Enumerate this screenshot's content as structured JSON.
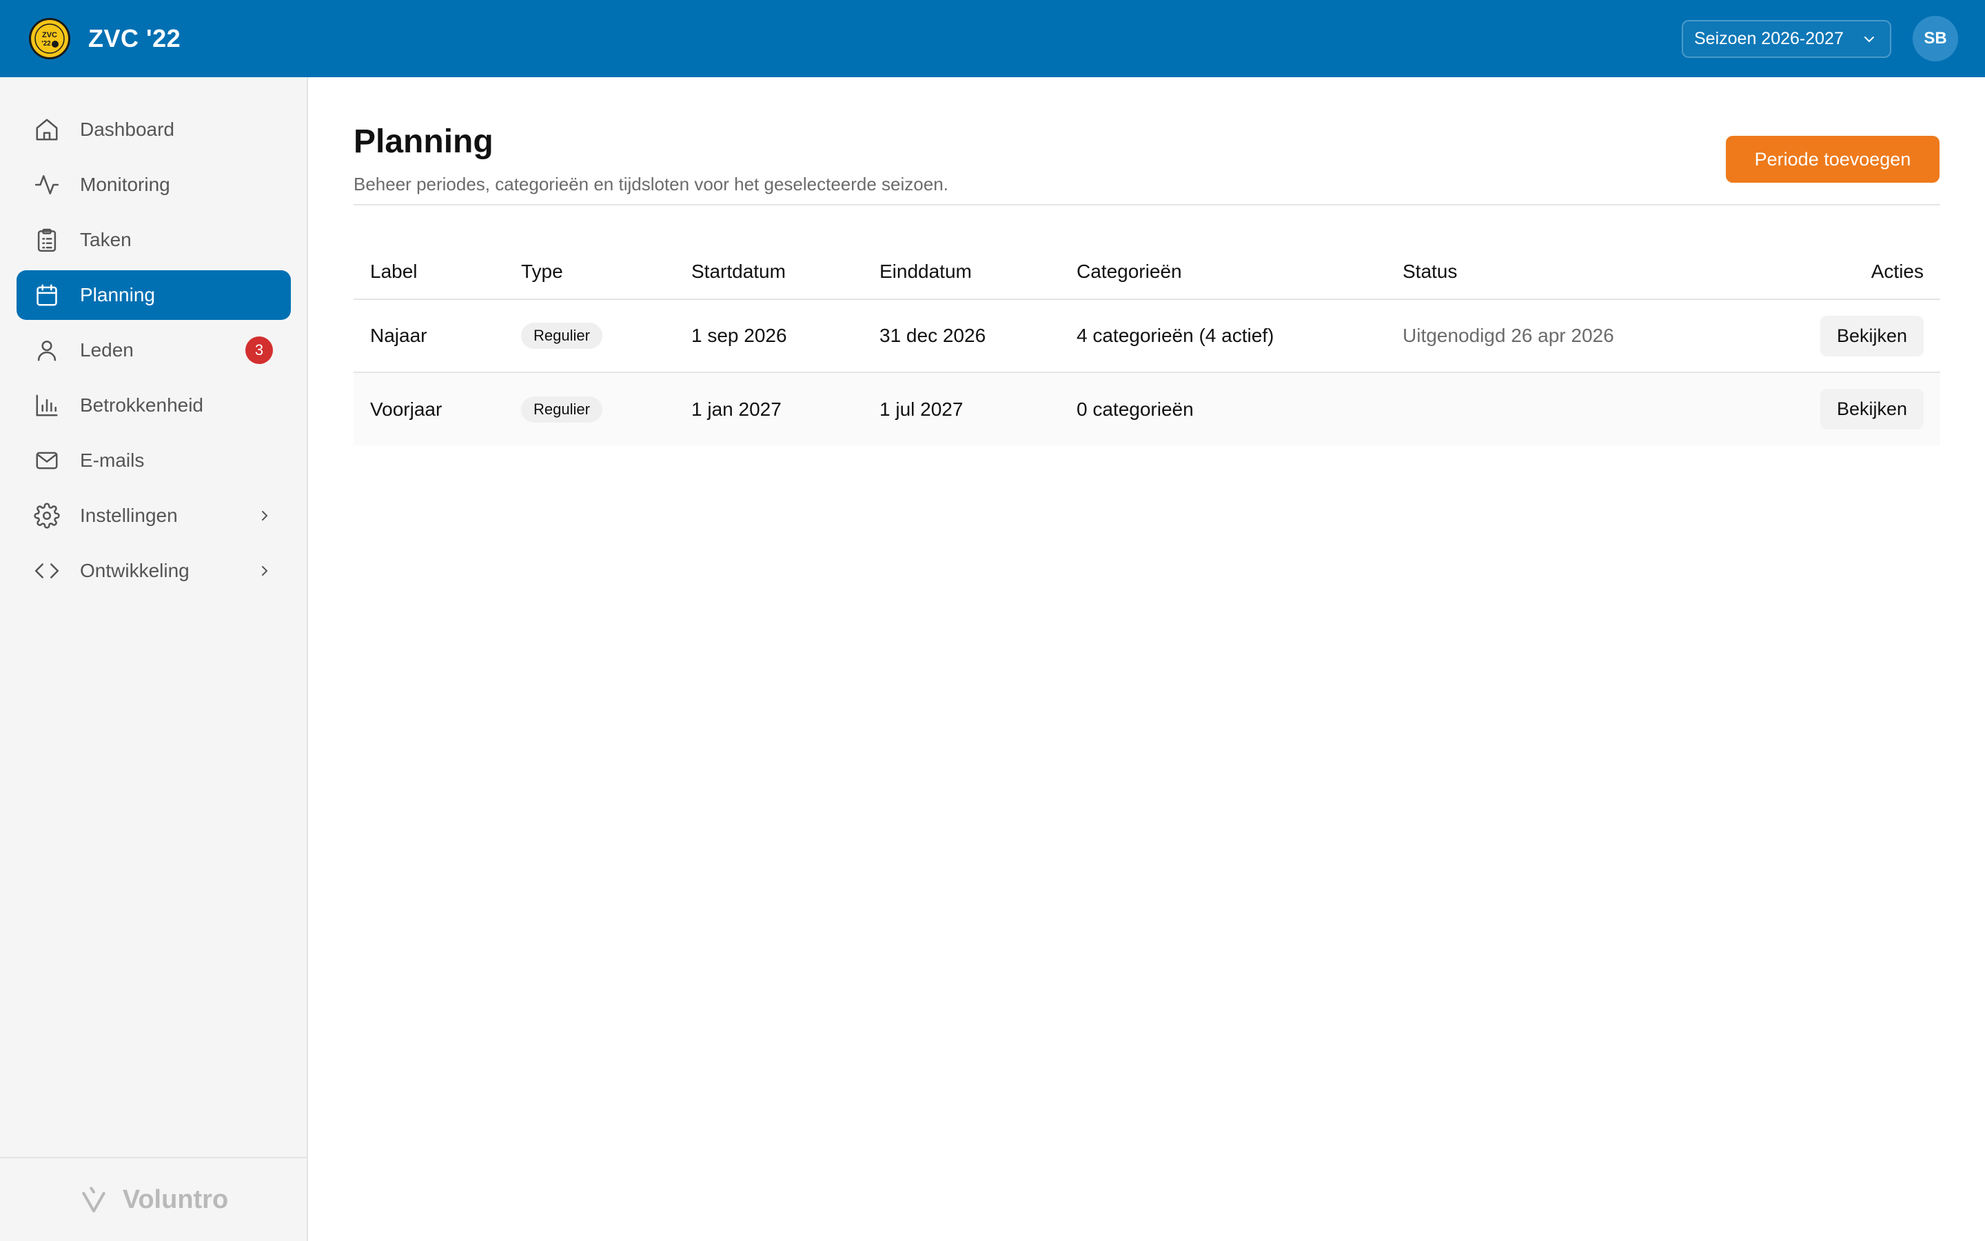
{
  "app": {
    "name": "ZVC '22",
    "logo_text": "ZVC '22"
  },
  "header": {
    "season_select": "Seizoen 2026-2027",
    "avatar_initials": "SB",
    "brand_color": "#0070B3"
  },
  "sidebar": {
    "items": [
      {
        "label": "Dashboard",
        "icon": "home-icon"
      },
      {
        "label": "Monitoring",
        "icon": "activity-icon"
      },
      {
        "label": "Taken",
        "icon": "clipboard-icon"
      },
      {
        "label": "Planning",
        "icon": "calendar-icon",
        "active": true
      },
      {
        "label": "Leden",
        "icon": "user-icon",
        "badge": "3"
      },
      {
        "label": "Betrokkenheid",
        "icon": "bar-chart-icon"
      },
      {
        "label": "E-mails",
        "icon": "mail-icon"
      },
      {
        "label": "Instellingen",
        "icon": "gear-icon",
        "has_submenu": true
      },
      {
        "label": "Ontwikkeling",
        "icon": "code-icon",
        "has_submenu": true
      }
    ],
    "footer_brand": "Voluntro"
  },
  "page": {
    "title": "Planning",
    "subtitle": "Beheer periodes, categorieën en tijdsloten voor het geselecteerde seizoen.",
    "add_button": "Periode toevoegen",
    "accent_color": "#EE7A1B"
  },
  "table": {
    "columns": [
      "Label",
      "Type",
      "Startdatum",
      "Einddatum",
      "Categorieën",
      "Status",
      "Acties"
    ],
    "rows": [
      {
        "label": "Najaar",
        "type": "Regulier",
        "start": "1 sep 2026",
        "end": "31 dec 2026",
        "categories": "4 categorieën (4 actief)",
        "status": "Uitgenodigd 26 apr 2026",
        "action": "Bekijken"
      },
      {
        "label": "Voorjaar",
        "type": "Regulier",
        "start": "1 jan 2027",
        "end": "1 jul 2027",
        "categories": "0 categorieën",
        "status": "",
        "action": "Bekijken"
      }
    ]
  }
}
